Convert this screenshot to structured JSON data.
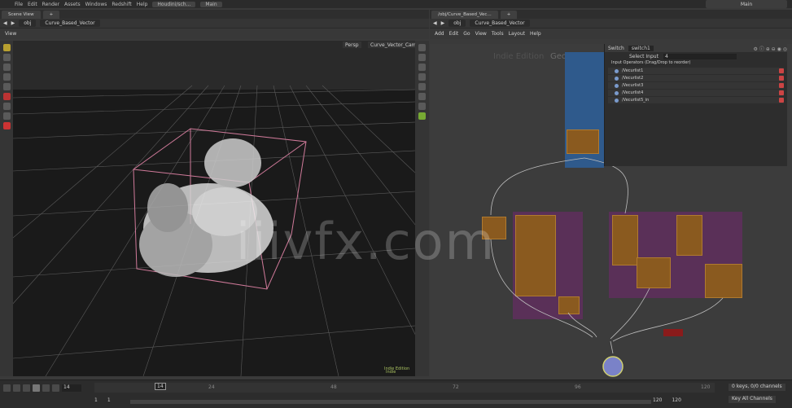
{
  "menubar": {
    "items": [
      "File",
      "Edit",
      "Render",
      "Assets",
      "Windows",
      "Redshift",
      "Help"
    ],
    "tab1": "Houdini/sch...",
    "tab2": "Main",
    "desktop": "Main"
  },
  "left": {
    "tab_title": "Scene View",
    "path_root": "obj",
    "path_node": "Curve_Based_Vector",
    "view_label": "View",
    "persp": "Persp",
    "camera": "Curve_Vector_Cam",
    "status": "Indie Edition"
  },
  "right": {
    "tab_title": "/obj/Curve_Based_Vec...",
    "path_root": "obj",
    "path_node": "Curve_Based_Vector",
    "menu": [
      "Add",
      "Edit",
      "Go",
      "View",
      "Tools",
      "Layout",
      "Help"
    ],
    "bg_label_1": "Indie Edition",
    "bg_label_2": "Geometry",
    "param": {
      "node_type": "Switch",
      "node_name": "switch1",
      "select_input_label": "Select Input",
      "select_input_value": "4",
      "input_ops_label": "Input Operators (Drag/Drop to reorder)",
      "inputs": [
        "/Vecurlist1",
        "/Vecurlist2",
        "/Vecurlist3",
        "/Vecurlist4",
        "/Vecurlist5_in"
      ]
    }
  },
  "timeline": {
    "current_frame": "14",
    "start": "1",
    "start2": "1",
    "end": "120",
    "end2": "120",
    "ruler_marks": [
      "24",
      "48",
      "72",
      "96",
      "120"
    ],
    "keys_label": "0 keys, 0/0 channels",
    "channels_label": "Key All Channels"
  },
  "watermark": "iiivfx.com"
}
